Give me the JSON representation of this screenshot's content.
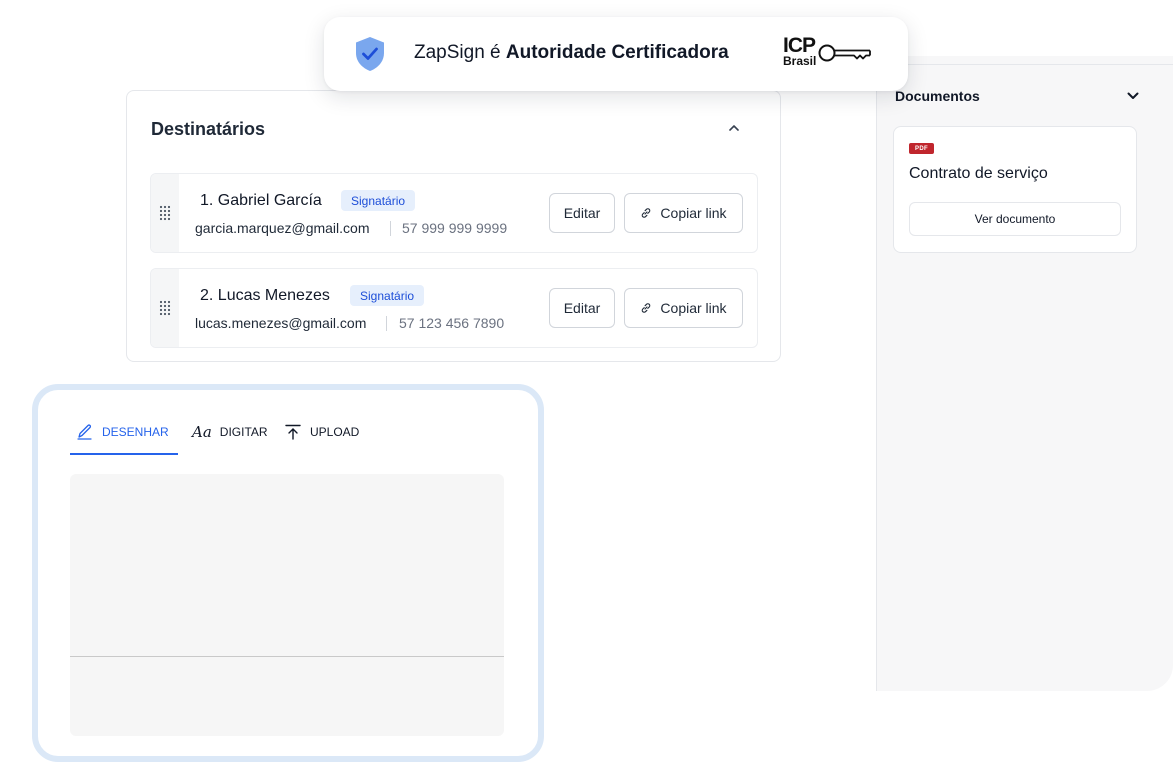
{
  "banner": {
    "prefix": "ZapSign é",
    "emphasis": "Autoridade Certificadora",
    "logo_top": "ICP",
    "logo_bottom": "Brasil",
    "shield_color": "#7aa7ee"
  },
  "documents": {
    "title": "Documentos",
    "badge": "PDF",
    "doc_name": "Contrato de serviço",
    "view_button": "Ver documento"
  },
  "recipients": {
    "title": "Destinatários",
    "rows": [
      {
        "name": "1. Gabriel García",
        "role": "Signatário",
        "email": "garcia.marquez@gmail.com",
        "phone": "57 999 999 9999",
        "edit": "Editar",
        "copy": "Copiar link"
      },
      {
        "name": "2. Lucas Menezes",
        "role": "Signatário",
        "email": "lucas.menezes@gmail.com",
        "phone": "57 123 456 7890",
        "edit": "Editar",
        "copy": "Copiar link"
      }
    ]
  },
  "signature": {
    "tabs": [
      {
        "label": "DESENHAR",
        "icon": "pen-icon",
        "active": true
      },
      {
        "label": "DIGITAR",
        "icon": "type-icon",
        "active": false
      },
      {
        "label": "UPLOAD",
        "icon": "upload-icon",
        "active": false
      }
    ]
  },
  "colors": {
    "accent": "#2563eb",
    "badge_bg": "#e6effc",
    "pdf_badge": "#c0262d",
    "pad_border": "#dbe8f7"
  }
}
